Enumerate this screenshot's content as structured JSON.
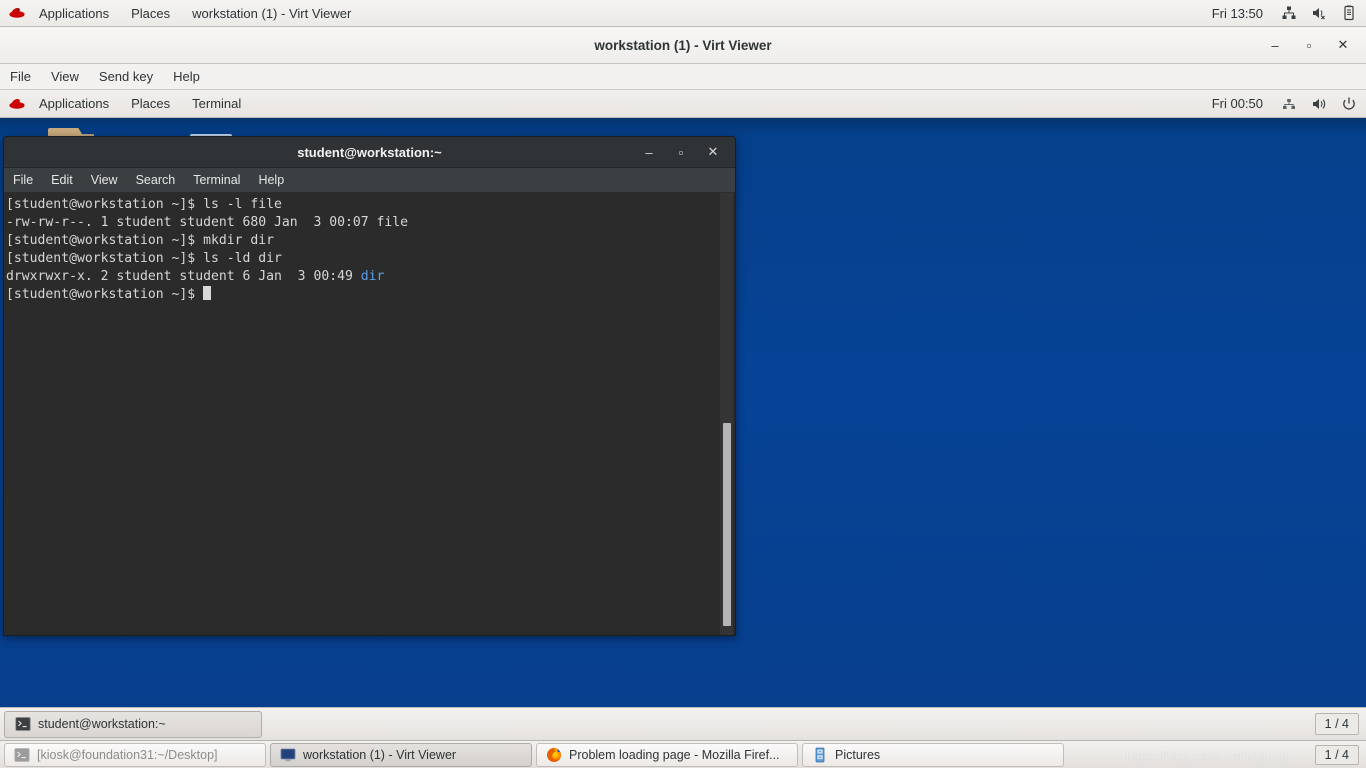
{
  "host_panel": {
    "logo": "redhat-logo",
    "applications": "Applications",
    "places": "Places",
    "window_title": "workstation (1) - Virt Viewer",
    "clock": "Fri 13:50",
    "tray": [
      "network-icon",
      "volume-muted-icon",
      "battery-icon"
    ]
  },
  "virt_viewer": {
    "title": "workstation (1) - Virt Viewer",
    "window_buttons": {
      "minimize": "–",
      "maximize": "▫",
      "close": "✕"
    },
    "menu": [
      "File",
      "View",
      "Send key",
      "Help"
    ]
  },
  "guest_panel": {
    "logo": "redhat-logo",
    "applications": "Applications",
    "places": "Places",
    "active_app": "Terminal",
    "clock": "Fri 00:50",
    "tray": [
      "network-icon",
      "volume-icon",
      "power-icon"
    ]
  },
  "terminal": {
    "title": "student@workstation:~",
    "window_buttons": {
      "minimize": "–",
      "maximize": "▫",
      "close": "✕"
    },
    "menu": [
      "File",
      "Edit",
      "View",
      "Search",
      "Terminal",
      "Help"
    ],
    "lines": [
      {
        "text": "[student@workstation ~]$ ls -l file"
      },
      {
        "text": "-rw-rw-r--. 1 student student 680 Jan  3 00:07 file"
      },
      {
        "text": "[student@workstation ~]$ mkdir dir"
      },
      {
        "text": "[student@workstation ~]$ ls -ld dir"
      },
      {
        "text": "drwxrwxr-x. 2 student student 6 Jan  3 00:49 ",
        "dir": "dir"
      },
      {
        "text": "[student@workstation ~]$ ",
        "cursor": true
      }
    ],
    "colors": {
      "background": "#2b2b2b",
      "foreground": "#d6d6d6",
      "dir_color": "#5c9ee8"
    }
  },
  "guest_taskbar": {
    "tasks": [
      {
        "label": "student@workstation:~",
        "icon": "terminal-icon",
        "state": "active"
      }
    ],
    "workspace": "1 / 4"
  },
  "host_taskbar": {
    "tasks": [
      {
        "label": "[kiosk@foundation31:~/Desktop]",
        "icon": "terminal-icon",
        "state": "minimized"
      },
      {
        "label": "workstation (1) - Virt Viewer",
        "icon": "display-icon",
        "state": "active"
      },
      {
        "label": "Problem loading page - Mozilla Firef...",
        "icon": "firefox-icon",
        "state": "normal"
      },
      {
        "label": "Pictures",
        "icon": "file-manager-icon",
        "state": "normal"
      }
    ],
    "workspace": "1 / 4"
  },
  "watermark": "https://blog.csdn.net/chitung",
  "desktop": {
    "background_color": "#05408c",
    "icons": [
      "folder-icon",
      "picture-icon"
    ]
  }
}
